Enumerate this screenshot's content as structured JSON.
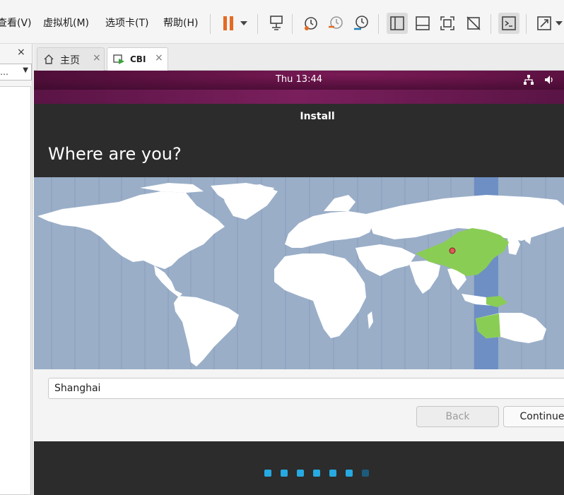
{
  "host": {
    "menu": [
      "查看(V)",
      "虚拟机(M)",
      "选项卡(T)",
      "帮助(H)"
    ],
    "left_panel": {
      "close": "×",
      "select_value": "…"
    },
    "tabs": [
      {
        "label": "主页",
        "close": "×"
      },
      {
        "label": "CBI",
        "close": "×"
      }
    ]
  },
  "vm": {
    "clock": "Thu 13:44",
    "installer": {
      "title": "Install",
      "heading": "Where are you?",
      "location_value": "Shanghai",
      "back_label": "Back",
      "continue_label": "Continue"
    },
    "progress": {
      "total": 7,
      "current": 6,
      "color_done": "#27a9e1",
      "color_todo": "#1c5b7c"
    }
  },
  "colors": {
    "accent_pause": "#e46b23",
    "map_water": "#9aaec8",
    "map_land": "#ffffff",
    "selected_region": "#8acd55",
    "selected_tz": "#6d8fc4"
  }
}
